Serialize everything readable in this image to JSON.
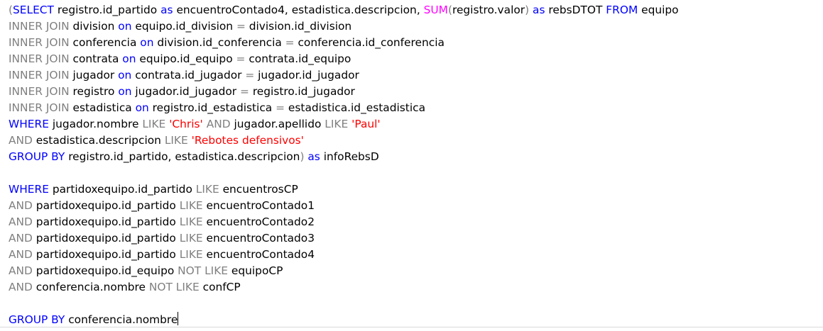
{
  "lines": [
    [
      [
        "g",
        "("
      ],
      [
        "k",
        "SELECT"
      ],
      [
        "t",
        " registro.id_partido "
      ],
      [
        "k",
        "as"
      ],
      [
        "t",
        " encuentroContado4, estadistica.descripcion, "
      ],
      [
        "f",
        "SUM"
      ],
      [
        "g",
        "("
      ],
      [
        "t",
        "registro.valor"
      ],
      [
        "g",
        ")"
      ],
      [
        "t",
        " "
      ],
      [
        "k",
        "as"
      ],
      [
        "t",
        " rebsDTOT "
      ],
      [
        "k",
        "FROM"
      ],
      [
        "t",
        " equipo"
      ]
    ],
    [
      [
        "g",
        "INNER JOIN"
      ],
      [
        "t",
        " division "
      ],
      [
        "k",
        "on"
      ],
      [
        "t",
        " equipo.id_division "
      ],
      [
        "g",
        "="
      ],
      [
        "t",
        " division.id_division"
      ]
    ],
    [
      [
        "g",
        "INNER JOIN"
      ],
      [
        "t",
        " conferencia "
      ],
      [
        "k",
        "on"
      ],
      [
        "t",
        " division.id_conferencia "
      ],
      [
        "g",
        "="
      ],
      [
        "t",
        " conferencia.id_conferencia"
      ]
    ],
    [
      [
        "g",
        "INNER JOIN"
      ],
      [
        "t",
        " contrata "
      ],
      [
        "k",
        "on"
      ],
      [
        "t",
        " equipo.id_equipo "
      ],
      [
        "g",
        "="
      ],
      [
        "t",
        " contrata.id_equipo"
      ]
    ],
    [
      [
        "g",
        "INNER JOIN"
      ],
      [
        "t",
        " jugador "
      ],
      [
        "k",
        "on"
      ],
      [
        "t",
        " contrata.id_jugador "
      ],
      [
        "g",
        "="
      ],
      [
        "t",
        " jugador.id_jugador"
      ]
    ],
    [
      [
        "g",
        "INNER JOIN"
      ],
      [
        "t",
        " registro "
      ],
      [
        "k",
        "on"
      ],
      [
        "t",
        " jugador.id_jugador "
      ],
      [
        "g",
        "="
      ],
      [
        "t",
        " registro.id_jugador"
      ]
    ],
    [
      [
        "g",
        "INNER JOIN"
      ],
      [
        "t",
        " estadistica "
      ],
      [
        "k",
        "on"
      ],
      [
        "t",
        " registro.id_estadistica "
      ],
      [
        "g",
        "="
      ],
      [
        "t",
        " estadistica.id_estadistica"
      ]
    ],
    [
      [
        "k",
        "WHERE"
      ],
      [
        "t",
        " jugador.nombre "
      ],
      [
        "g",
        "LIKE"
      ],
      [
        "t",
        " "
      ],
      [
        "s",
        "'Chris'"
      ],
      [
        "t",
        " "
      ],
      [
        "g",
        "AND"
      ],
      [
        "t",
        " jugador.apellido "
      ],
      [
        "g",
        "LIKE"
      ],
      [
        "t",
        " "
      ],
      [
        "s",
        "'Paul'"
      ]
    ],
    [
      [
        "g",
        "AND"
      ],
      [
        "t",
        " estadistica.descripcion "
      ],
      [
        "g",
        "LIKE"
      ],
      [
        "t",
        " "
      ],
      [
        "s",
        "'Rebotes defensivos'"
      ]
    ],
    [
      [
        "k",
        "GROUP BY"
      ],
      [
        "t",
        " registro.id_partido, estadistica.descripcion"
      ],
      [
        "g",
        ")"
      ],
      [
        "t",
        " "
      ],
      [
        "k",
        "as"
      ],
      [
        "t",
        " infoRebsD"
      ]
    ],
    [],
    [
      [
        "k",
        "WHERE"
      ],
      [
        "t",
        " partidoxequipo.id_partido "
      ],
      [
        "g",
        "LIKE"
      ],
      [
        "t",
        " encuentrosCP"
      ]
    ],
    [
      [
        "g",
        "AND"
      ],
      [
        "t",
        " partidoxequipo.id_partido "
      ],
      [
        "g",
        "LIKE"
      ],
      [
        "t",
        " encuentroContado1"
      ]
    ],
    [
      [
        "g",
        "AND"
      ],
      [
        "t",
        " partidoxequipo.id_partido "
      ],
      [
        "g",
        "LIKE"
      ],
      [
        "t",
        " encuentroContado2"
      ]
    ],
    [
      [
        "g",
        "AND"
      ],
      [
        "t",
        " partidoxequipo.id_partido "
      ],
      [
        "g",
        "LIKE"
      ],
      [
        "t",
        " encuentroContado3"
      ]
    ],
    [
      [
        "g",
        "AND"
      ],
      [
        "t",
        " partidoxequipo.id_partido "
      ],
      [
        "g",
        "LIKE"
      ],
      [
        "t",
        " encuentroContado4"
      ]
    ],
    [
      [
        "g",
        "AND"
      ],
      [
        "t",
        " partidoxequipo.id_equipo "
      ],
      [
        "g",
        "NOT LIKE"
      ],
      [
        "t",
        " equipoCP"
      ]
    ],
    [
      [
        "g",
        "AND"
      ],
      [
        "t",
        " conferencia.nombre "
      ],
      [
        "g",
        "NOT LIKE"
      ],
      [
        "t",
        " confCP"
      ]
    ],
    [],
    [
      [
        "k",
        "GROUP BY"
      ],
      [
        "t",
        " conferencia.nombre"
      ]
    ]
  ],
  "colors": {
    "keyword": "#0000ff",
    "operator": "#808080",
    "string": "#ff0000",
    "function": "#ff00ff",
    "text": "#000000"
  }
}
